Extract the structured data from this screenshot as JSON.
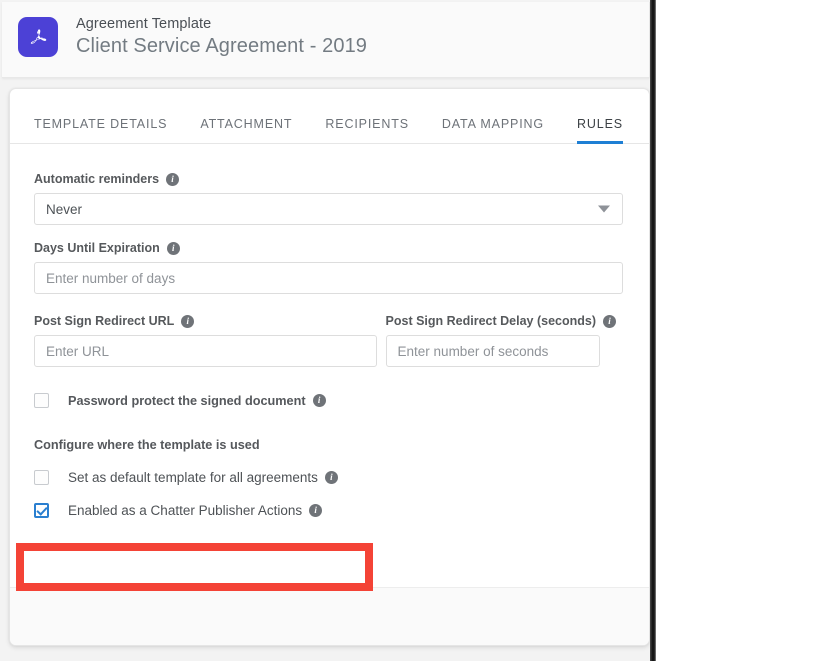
{
  "header": {
    "icon": "adobe-pdf-icon",
    "eyebrow": "Agreement Template",
    "title": "Client Service Agreement - 2019"
  },
  "tabs": [
    {
      "label": "TEMPLATE DETAILS",
      "active": false
    },
    {
      "label": "ATTACHMENT",
      "active": false
    },
    {
      "label": "RECIPIENTS",
      "active": false
    },
    {
      "label": "DATA MAPPING",
      "active": false
    },
    {
      "label": "RULES",
      "active": true
    }
  ],
  "form": {
    "automatic_reminders": {
      "label": "Automatic reminders",
      "value": "Never",
      "info": "i"
    },
    "days_until_expiration": {
      "label": "Days Until Expiration",
      "placeholder": "Enter number of days",
      "value": "",
      "info": "i"
    },
    "post_sign_redirect_url": {
      "label": "Post Sign Redirect URL",
      "placeholder": "Enter URL",
      "value": "",
      "info": "i"
    },
    "post_sign_redirect_delay": {
      "label": "Post Sign Redirect Delay (seconds)",
      "placeholder": "Enter number of seconds",
      "value": "",
      "info": "i"
    },
    "password_protect": {
      "label": "Password protect the signed document",
      "checked": false,
      "info": "i"
    },
    "configure_section_heading": "Configure where the template is used",
    "set_default_template": {
      "label": "Set as default template for all agreements",
      "checked": false,
      "info": "i"
    },
    "chatter_publisher": {
      "label": "Enabled as a Chatter Publisher Actions",
      "checked": true,
      "info": "i"
    }
  },
  "colors": {
    "accent_blue": "#1e7fd4",
    "checkbox_blue": "#2a7fd0",
    "pdf_purple": "#4c41d6",
    "highlight_red": "#f44336"
  }
}
